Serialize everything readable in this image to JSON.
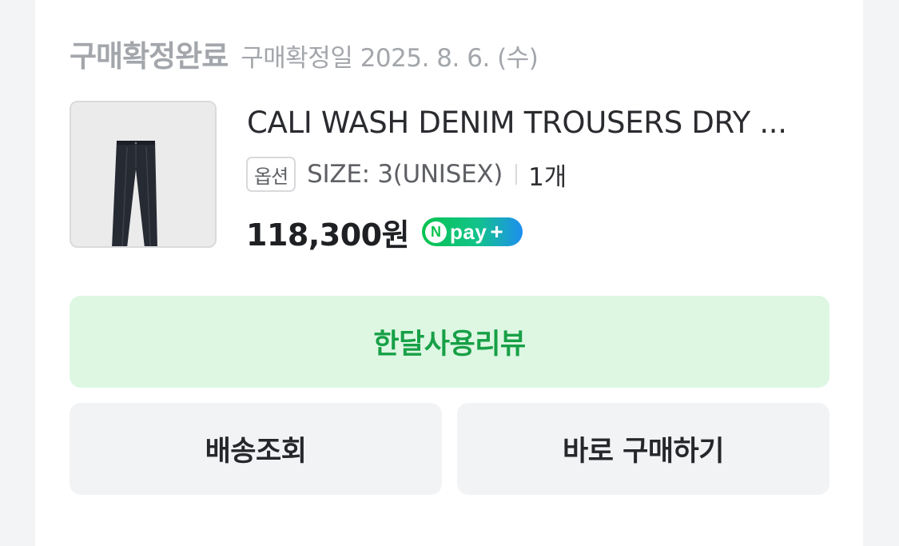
{
  "order": {
    "status": "구매확정완료",
    "confirm_date": "구매확정일 2025. 8. 6. (수)"
  },
  "product": {
    "name": "CALI WASH DENIM TROUSERS DRY ...",
    "option_badge": "옵션",
    "option_value": "SIZE: 3(UNISEX)",
    "quantity": "1개",
    "price": "118,300원",
    "pay_badge": {
      "n": "N",
      "text": "pay",
      "plus": "+"
    }
  },
  "actions": {
    "review": "한달사용리뷰",
    "track_delivery": "배송조회",
    "buy_now": "바로 구매하기"
  },
  "colors": {
    "review_bg": "#ddf7e3",
    "review_text": "#17a046",
    "secondary_bg": "#f2f3f5",
    "npay_green": "#07c34f"
  }
}
